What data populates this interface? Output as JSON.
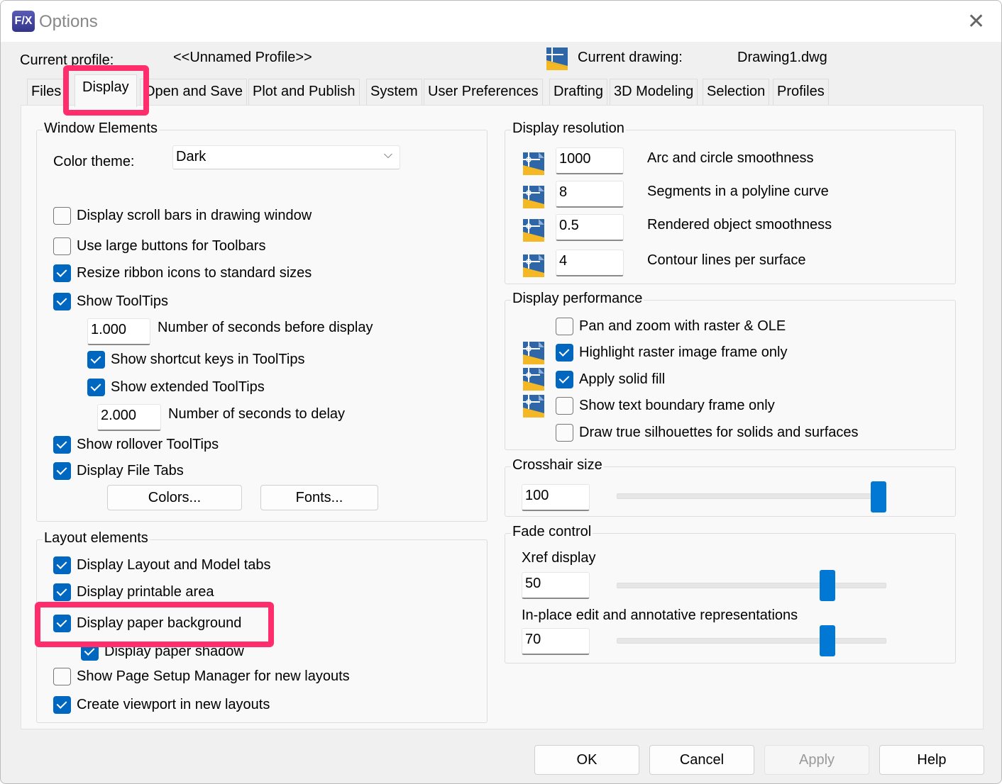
{
  "window": {
    "title": "Options",
    "logo": "F/X",
    "close": "✕"
  },
  "header": {
    "profile_label": "Current profile:",
    "profile_value": "<<Unnamed Profile>>",
    "drawing_label": "Current drawing:",
    "drawing_value": "Drawing1.dwg"
  },
  "tabs": [
    "Files",
    "Display",
    "Open and Save",
    "Plot and Publish",
    "System",
    "User Preferences",
    "Drafting",
    "3D Modeling",
    "Selection",
    "Profiles"
  ],
  "window_elements": {
    "title": "Window Elements",
    "color_theme_label": "Color theme:",
    "color_theme_value": "Dark",
    "checks": [
      {
        "label": "Display scroll bars in drawing window",
        "checked": false
      },
      {
        "label": "Use large buttons for Toolbars",
        "checked": false
      },
      {
        "label": "Resize ribbon icons to standard sizes",
        "checked": true
      },
      {
        "label": "Show ToolTips",
        "checked": true
      },
      {
        "label": "Show shortcut keys in ToolTips",
        "checked": true
      },
      {
        "label": "Show extended ToolTips",
        "checked": true
      },
      {
        "label": "Show rollover ToolTips",
        "checked": true
      },
      {
        "label": "Display File Tabs",
        "checked": true
      }
    ],
    "tooltip_delay": "1.000",
    "tooltip_delay_label": "Number of seconds before display",
    "extended_delay": "2.000",
    "extended_delay_label": "Number of seconds to delay",
    "colors_button": "Colors...",
    "fonts_button": "Fonts..."
  },
  "layout_elements": {
    "title": "Layout elements",
    "checks": [
      {
        "label": "Display Layout and Model tabs",
        "checked": true
      },
      {
        "label": "Display printable area",
        "checked": true
      },
      {
        "label": "Display paper background",
        "checked": true
      },
      {
        "label": "Display paper shadow",
        "checked": true
      },
      {
        "label": "Show Page Setup Manager for new layouts",
        "checked": false
      },
      {
        "label": "Create viewport in new layouts",
        "checked": true
      }
    ]
  },
  "display_resolution": {
    "title": "Display resolution",
    "rows": [
      {
        "value": "1000",
        "label": "Arc and circle smoothness"
      },
      {
        "value": "8",
        "label": "Segments in a polyline curve"
      },
      {
        "value": "0.5",
        "label": "Rendered object smoothness"
      },
      {
        "value": "4",
        "label": "Contour lines per surface"
      }
    ]
  },
  "display_performance": {
    "title": "Display performance",
    "checks": [
      {
        "label": "Pan and zoom with raster & OLE",
        "checked": false
      },
      {
        "label": "Highlight raster image frame only",
        "checked": true
      },
      {
        "label": "Apply solid fill",
        "checked": true
      },
      {
        "label": "Show text boundary frame only",
        "checked": false
      },
      {
        "label": "Draw true silhouettes for solids and surfaces",
        "checked": false
      }
    ]
  },
  "crosshair": {
    "title": "Crosshair size",
    "value": "100",
    "percent": 100
  },
  "fade": {
    "title": "Fade control",
    "xref_label": "Xref display",
    "xref_value": "50",
    "xref_percent": 80,
    "inplace_label": "In-place edit and annotative representations",
    "inplace_value": "70",
    "inplace_percent": 80
  },
  "buttons": {
    "ok": "OK",
    "cancel": "Cancel",
    "apply": "Apply",
    "help": "Help"
  },
  "colors": {
    "accent": "#0067c0",
    "highlight": "#ff2d6b"
  }
}
